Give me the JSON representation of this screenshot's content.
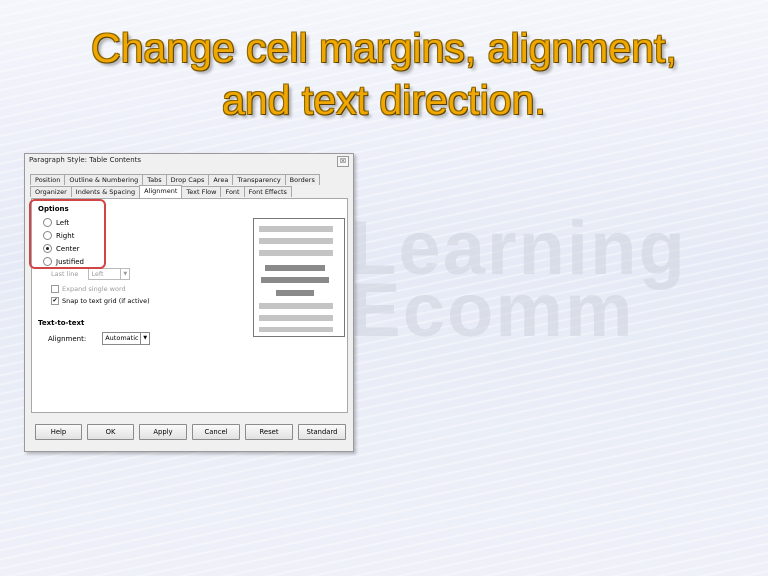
{
  "slide": {
    "title_line1": "Change cell margins, alignment,",
    "title_line2": "and text direction."
  },
  "watermark": {
    "line1": "Learning",
    "line2": "Ecomm"
  },
  "dialog": {
    "title": "Paragraph Style: Table Contents",
    "close_label": "☒",
    "tabs_row1": [
      "Position",
      "Outline & Numbering",
      "Tabs",
      "Drop Caps",
      "Area",
      "Transparency",
      "Borders"
    ],
    "tabs_row2": [
      "Organizer",
      "Indents & Spacing",
      "Alignment",
      "Text Flow",
      "Font",
      "Font Effects"
    ],
    "active_tab": "Alignment",
    "options": {
      "heading": "Options",
      "radios": [
        {
          "label": "Left",
          "checked": false
        },
        {
          "label": "Right",
          "checked": false
        },
        {
          "label": "Center",
          "checked": true
        },
        {
          "label": "Justified",
          "checked": false
        }
      ],
      "last_line_label": "Last line",
      "last_line_value": "Left",
      "expand_single_word": "Expand single word",
      "snap_to_grid": "Snap to text grid (if active)"
    },
    "text_to_text": {
      "heading": "Text-to-text",
      "alignment_label": "Alignment:",
      "alignment_value": "Automatic"
    },
    "buttons": [
      "Help",
      "OK",
      "Apply",
      "Cancel",
      "Reset",
      "Standard"
    ],
    "highlight_color": "#d04545"
  }
}
